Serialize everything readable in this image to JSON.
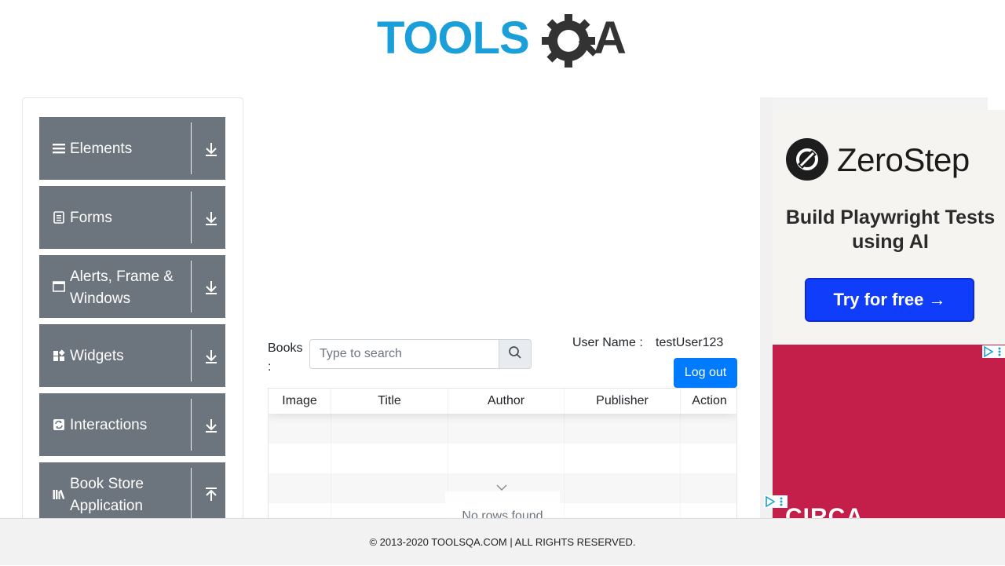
{
  "header": {
    "logo_text_left": "TOOLS",
    "logo_text_right": "QA"
  },
  "sidebar": {
    "groups": [
      {
        "label": "Elements",
        "icon": "menu-icon",
        "arrow": "download-arrow-icon"
      },
      {
        "label": "Forms",
        "icon": "document-icon",
        "arrow": "download-arrow-icon"
      },
      {
        "label": "Alerts, Frame & Windows",
        "icon": "window-icon",
        "arrow": "download-arrow-icon"
      },
      {
        "label": "Widgets",
        "icon": "widgets-icon",
        "arrow": "download-arrow-icon"
      },
      {
        "label": "Interactions",
        "icon": "interactions-icon",
        "arrow": "download-arrow-icon"
      },
      {
        "label": "Book Store Application",
        "icon": "books-icon",
        "arrow": "upload-arrow-icon"
      }
    ]
  },
  "books": {
    "label": "Books :",
    "search_placeholder": "Type to search",
    "user_label": "User Name :",
    "user_value": "testUser123",
    "logout_label": "Log out",
    "columns": [
      "Image",
      "Title",
      "Author",
      "Publisher",
      "Action"
    ],
    "no_rows": "No rows found"
  },
  "ads": {
    "brand": "ZeroStep",
    "tagline": "Build Playwright Tests using AI",
    "cta": "Try for free →",
    "bottom_text": "CIRCA"
  },
  "footer": {
    "text": "© 2013-2020 TOOLSQA.COM | ALL RIGHTS RESERVED."
  },
  "colors": {
    "sidebar_group": "#6c757d",
    "primary": "#007bff",
    "logo_blue": "#1a9fd9",
    "logo_dark": "#333333",
    "ad_red": "#c41e4a",
    "ad_blue": "#0f3dfa"
  }
}
